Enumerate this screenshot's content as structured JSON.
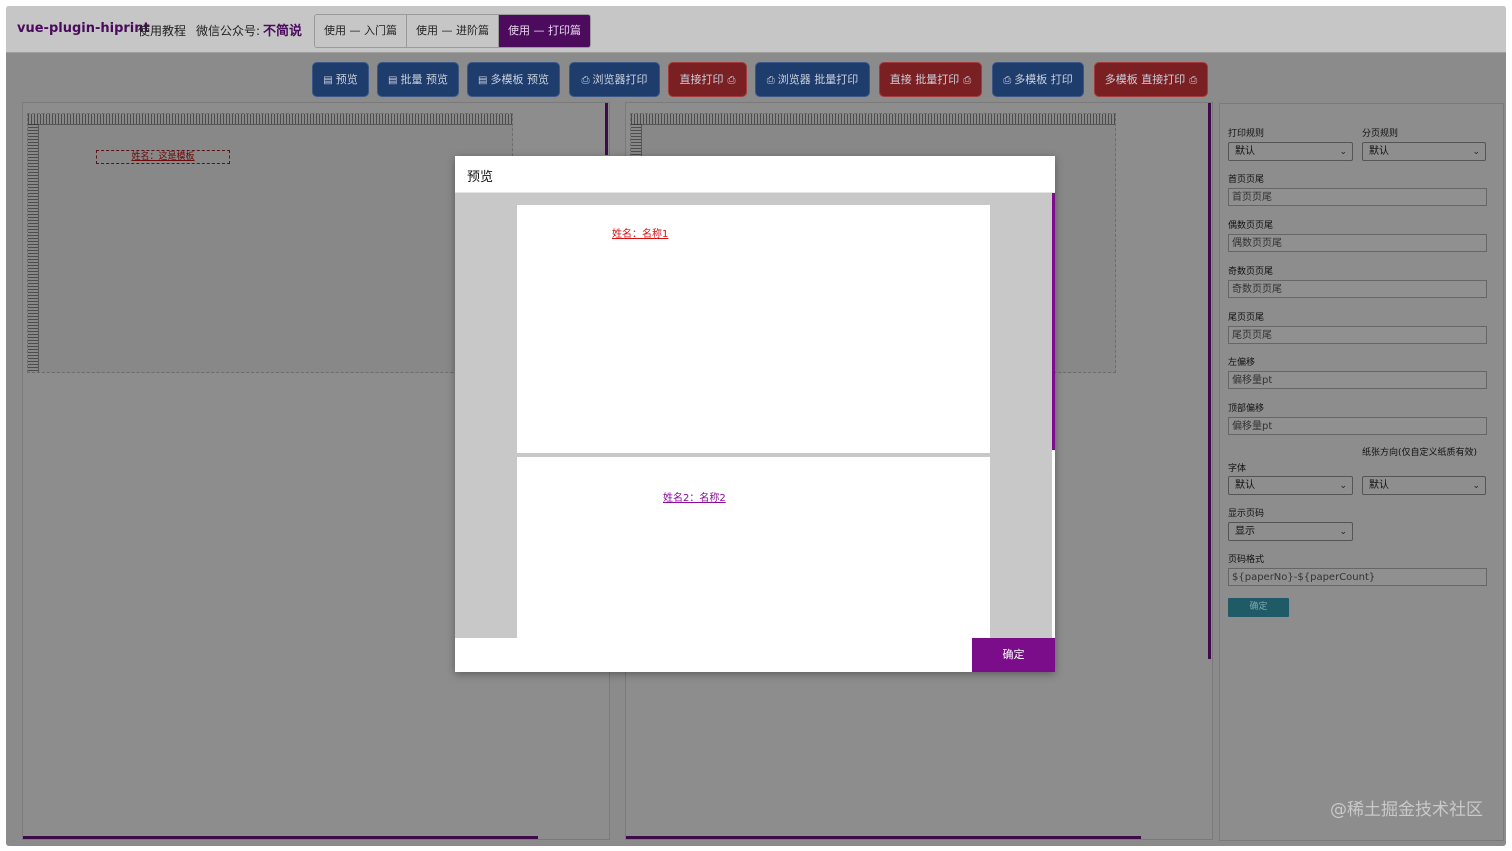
{
  "header": {
    "brand": "vue-plugin-hiprint",
    "brand_sub": "使用教程",
    "wechat_label": "微信公众号:",
    "wechat_name": "不简说",
    "tabs": [
      {
        "label": "使用 — 入门篇",
        "active": false
      },
      {
        "label": "使用 — 进阶篇",
        "active": false
      },
      {
        "label": "使用 — 打印篇",
        "active": true
      }
    ]
  },
  "toolbar": {
    "buttons": [
      {
        "label": "预览",
        "icon": "document-icon",
        "color": "blue"
      },
      {
        "label": "批量 预览",
        "icon": "document-icon",
        "color": "blue"
      },
      {
        "label": "多模板 预览",
        "icon": "document-icon",
        "color": "blue"
      },
      {
        "label": "浏览器打印",
        "icon": "printer-icon",
        "color": "blue"
      },
      {
        "label": "直接打印",
        "icon": "printer-icon",
        "color": "red"
      },
      {
        "label": "浏览器 批量打印",
        "icon": "printer-icon",
        "color": "blue"
      },
      {
        "label": "直接 批量打印",
        "icon": "printer-icon",
        "color": "red"
      },
      {
        "label": "多模板 打印",
        "icon": "printer-icon",
        "color": "blue"
      },
      {
        "label": "多模板 直接打印",
        "icon": "printer-icon",
        "color": "red"
      }
    ]
  },
  "designer": {
    "field_text": "姓名：这是模板"
  },
  "settings": {
    "print_rule_label": "打印规则",
    "print_rule_value": "默认",
    "page_rule_label": "分页规则",
    "page_rule_value": "默认",
    "first_footer_label": "首页页尾",
    "first_footer_placeholder": "首页页尾",
    "even_footer_label": "偶数页页尾",
    "even_footer_placeholder": "偶数页页尾",
    "odd_footer_label": "奇数页页尾",
    "odd_footer_placeholder": "奇数页页尾",
    "last_footer_label": "尾页页尾",
    "last_footer_placeholder": "尾页页尾",
    "left_offset_label": "左偏移",
    "left_offset_placeholder": "偏移量pt",
    "top_offset_label": "顶部偏移",
    "top_offset_placeholder": "偏移量pt",
    "font_label": "字体",
    "font_value": "默认",
    "orientation_label": "纸张方向(仅自定义纸质有效)",
    "orientation_value": "默认",
    "show_page_label": "显示页码",
    "show_page_value": "显示",
    "page_format_label": "页码格式",
    "page_format_value": "${paperNo}-${paperCount}",
    "confirm_label": "确定"
  },
  "watermark": "@稀土掘金技术社区",
  "modal": {
    "title": "预览",
    "page1_text": "姓名：名称1",
    "page2_text": "姓名2：名称2",
    "ok_label": "确定"
  },
  "colors": {
    "accent_purple": "#7b0c8a",
    "button_blue": "#1f3d6c",
    "button_red": "#7a2023"
  }
}
